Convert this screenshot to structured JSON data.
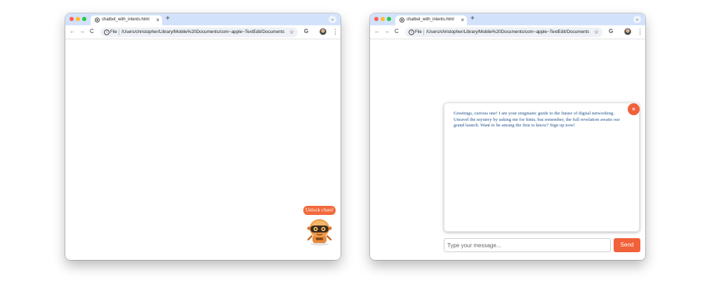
{
  "browser_left": {
    "tab_title": "chatbot_with_intents.html",
    "tab_close": "×",
    "new_tab": "+",
    "tab_menu": "⌄",
    "back": "←",
    "forward": "→",
    "reload": "C",
    "info_icon": "i",
    "file_label": "File",
    "url": "/Users/christopher/Library/Mobile%20Documents/com~apple~TextEdit/Documents/...",
    "bookmark": "☆",
    "google_icon": "G",
    "menu": "⋮"
  },
  "browser_right": {
    "tab_title": "chatbot_with_intents.html",
    "tab_close": "×",
    "new_tab": "+",
    "tab_menu": "⌄",
    "back": "←",
    "forward": "→",
    "reload": "C",
    "info_icon": "i",
    "file_label": "File",
    "url": "/Users/christopher/Library/Mobile%20Documents/com~apple~TextEdit/Documents/...",
    "bookmark": "☆",
    "google_icon": "G",
    "menu": "⋮"
  },
  "launcher": {
    "badge_label": "Unlock clues!",
    "icon": "robot-mascot-icon"
  },
  "chat": {
    "message": "Greetings, curious one! I am your enigmatic guide to the future of digital networking. Unravel the mystery by asking me for hints, but remember, the full revelation awaits our grand launch. Want to be among the first to know? Sign up now!",
    "close_label": "×",
    "input_placeholder": "Type your message...",
    "input_value": "",
    "send_label": "Send"
  },
  "colors": {
    "accent": "#f26a3d",
    "tab_bar": "#d3e2fb",
    "message_text": "#1e4f8a"
  }
}
